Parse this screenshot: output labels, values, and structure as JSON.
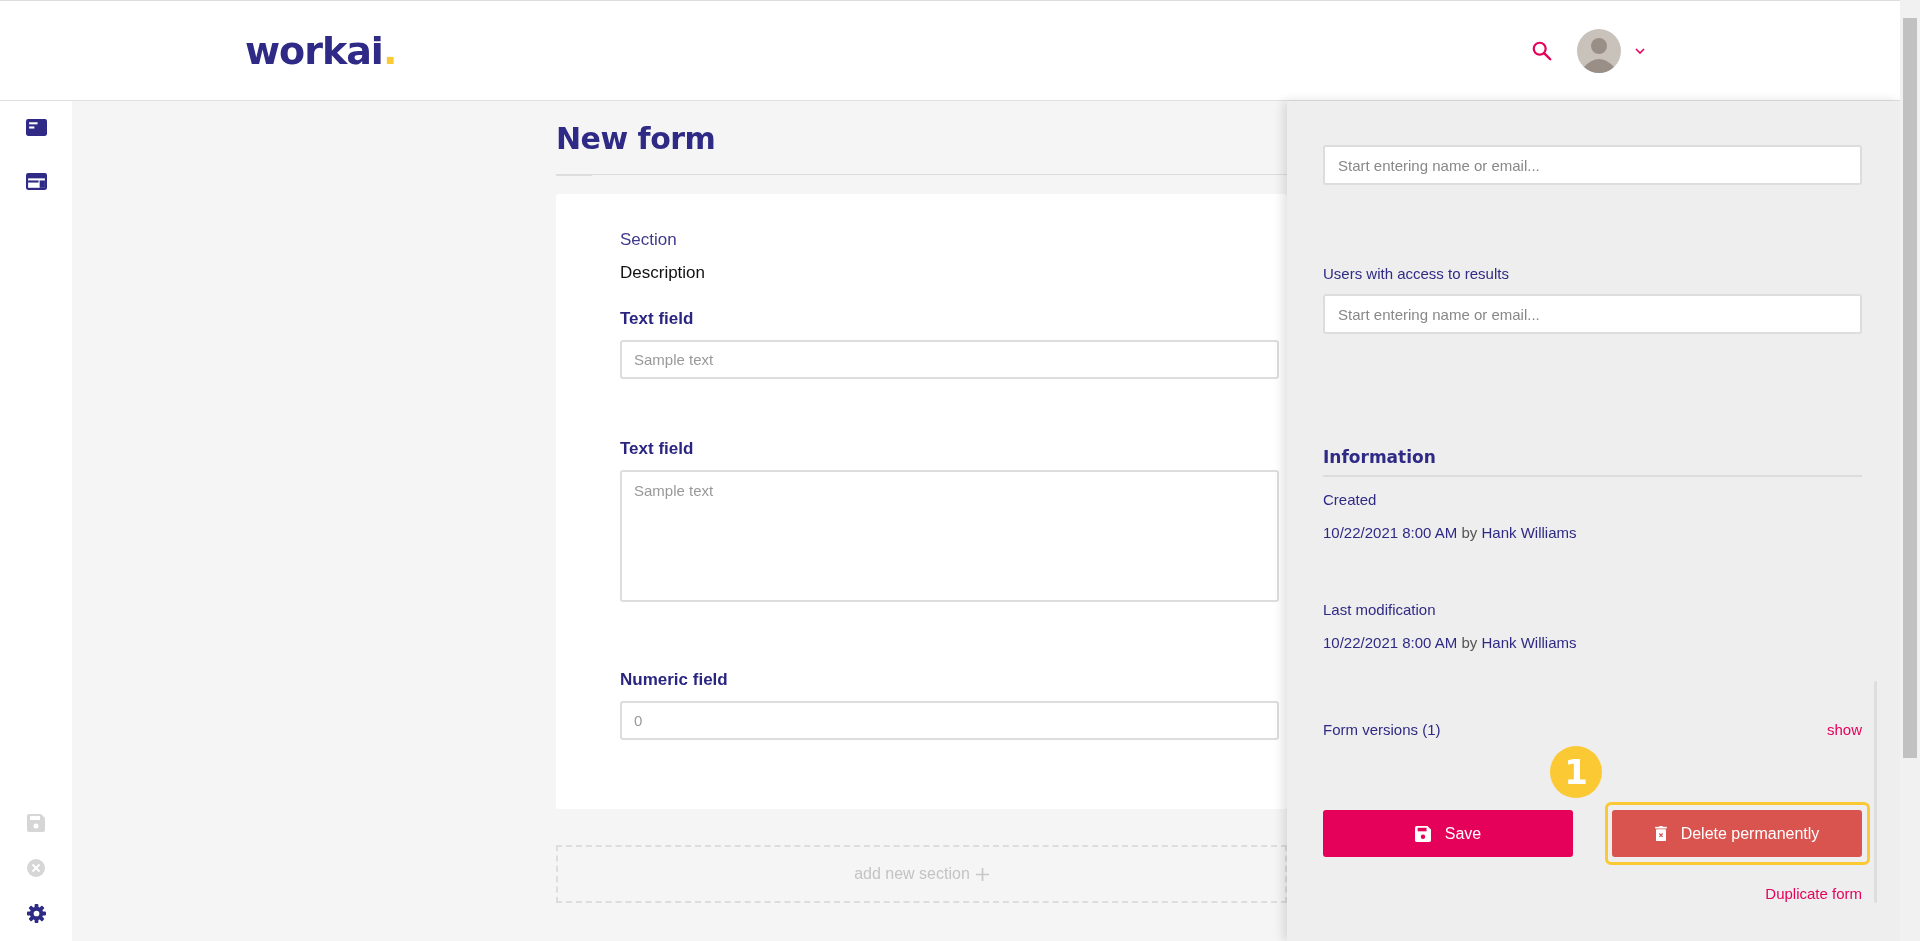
{
  "header": {
    "logo": {
      "text": "workai",
      "dot": "."
    }
  },
  "sidebar": {
    "top_items": [
      {
        "kind": "card"
      },
      {
        "kind": "layout"
      }
    ],
    "bottom_items": [
      {
        "kind": "save",
        "disabled": true
      },
      {
        "kind": "cancel",
        "disabled": true
      },
      {
        "kind": "settings",
        "disabled": false
      }
    ]
  },
  "form": {
    "title": "New form",
    "section": {
      "title": "Section",
      "description": "Description",
      "fields": [
        {
          "kind": "text",
          "label": "Text field",
          "placeholder": "Sample text"
        },
        {
          "kind": "textarea",
          "label": "Text field",
          "placeholder": "Sample text"
        },
        {
          "kind": "number",
          "label": "Numeric field",
          "placeholder": "0"
        }
      ]
    },
    "add_section": "add new section"
  },
  "panel": {
    "fields": [
      {
        "placeholder": "Start entering name or email..."
      },
      {
        "label": "Users with access to results",
        "placeholder": "Start entering name or email..."
      }
    ],
    "information": {
      "title": "Information",
      "entries": [
        {
          "label": "Created",
          "date": "10/22/2021 8:00 AM",
          "by": "by",
          "user": "Hank Williams"
        },
        {
          "label": "Last modification",
          "date": "10/22/2021 8:00 AM",
          "by": "by",
          "user": "Hank Williams"
        }
      ]
    },
    "versions": {
      "label": "Form versions (1)",
      "link": "show"
    },
    "actions": [
      {
        "kind": "save",
        "label": "Save",
        "highlighted": false
      },
      {
        "kind": "delete",
        "label": "Delete permanently",
        "highlighted": true
      }
    ],
    "callout": "1",
    "duplicate": "Duplicate form"
  }
}
